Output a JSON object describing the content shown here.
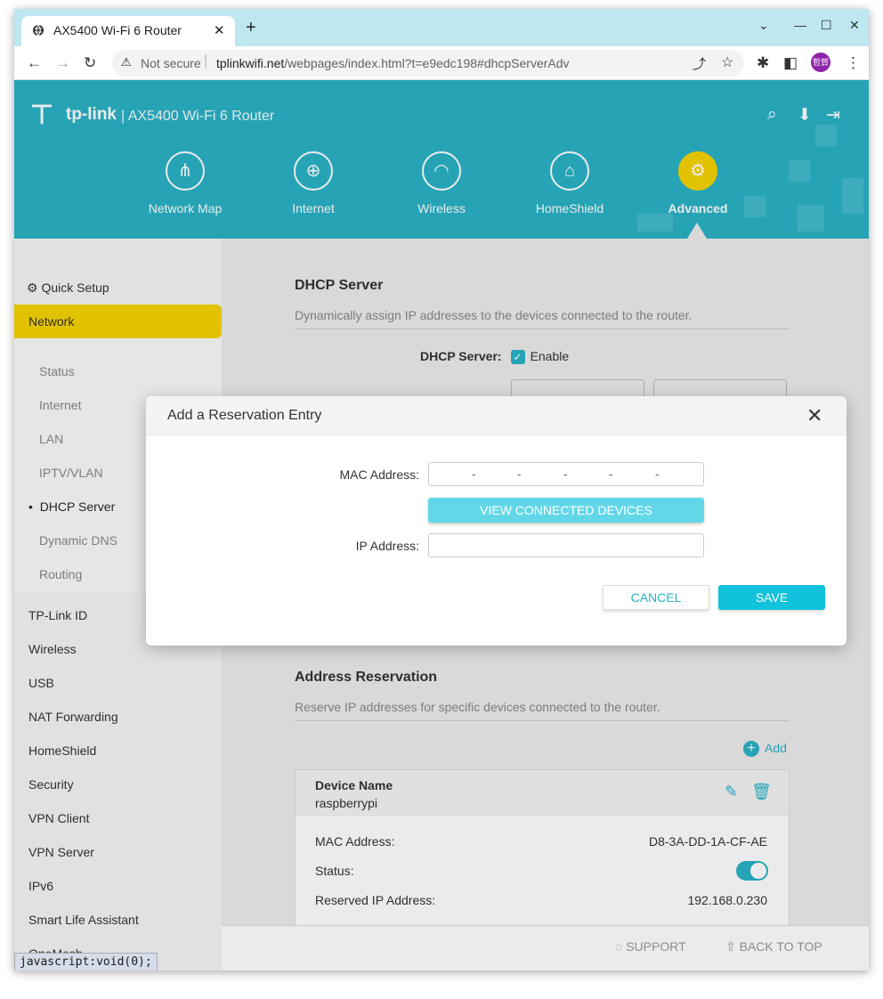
{
  "browser": {
    "tab_title": "AX5400 Wi-Fi 6 Router",
    "not_secure": "Not secure",
    "url_host": "tplinkwifi.net",
    "url_path": "/webpages/index.html?t=e9edc198#dhcpServerAdv",
    "avatar_text": "哲賀",
    "status_bar": "javascript:void(0);"
  },
  "header": {
    "brand": "tp-link",
    "model": "AX5400 Wi-Fi 6 Router",
    "nav": [
      {
        "label": "Network Map",
        "icon": "network-map-icon"
      },
      {
        "label": "Internet",
        "icon": "globe-icon"
      },
      {
        "label": "Wireless",
        "icon": "wifi-icon"
      },
      {
        "label": "HomeShield",
        "icon": "home-shield-icon"
      },
      {
        "label": "Advanced",
        "icon": "gear-icon",
        "active": true
      }
    ]
  },
  "sidebar": {
    "quick_setup": "Quick Setup",
    "network": "Network",
    "network_items": [
      "Status",
      "Internet",
      "LAN",
      "IPTV/VLAN",
      "DHCP Server",
      "Dynamic DNS",
      "Routing"
    ],
    "selected_item": "DHCP Server",
    "items": [
      "TP-Link ID",
      "Wireless",
      "USB",
      "NAT Forwarding",
      "HomeShield",
      "Security",
      "VPN Client",
      "VPN Server",
      "IPv6",
      "Smart Life Assistant",
      "OneMesh"
    ]
  },
  "dhcp": {
    "title": "DHCP Server",
    "description": "Dynamically assign IP addresses to the devices connected to the router.",
    "label": "DHCP Server:",
    "enable_label": "Enable",
    "enabled": true
  },
  "reservation": {
    "title": "Address Reservation",
    "description": "Reserve IP addresses for specific devices connected to the router.",
    "add_label": "Add",
    "device_name_header": "Device Name",
    "device_name": "raspberrypi",
    "mac_label": "MAC Address:",
    "mac_value": "D8-3A-DD-1A-CF-AE",
    "status_label": "Status:",
    "status_on": true,
    "ip_label": "Reserved IP Address:",
    "ip_value": "192.168.0.230"
  },
  "footer": {
    "support": "SUPPORT",
    "back_to_top": "BACK TO TOP"
  },
  "modal": {
    "title": "Add a Reservation Entry",
    "mac_label": "MAC Address:",
    "mac_separators": [
      "-",
      "-",
      "-",
      "-",
      "-"
    ],
    "view_devices": "VIEW CONNECTED DEVICES",
    "ip_label": "IP Address:",
    "ip_value": "",
    "cancel": "CANCEL",
    "save": "SAVE"
  },
  "colors": {
    "brand_teal": "#2ab2c6",
    "active_yellow": "#f5d300",
    "save_button": "#10c2dc"
  }
}
